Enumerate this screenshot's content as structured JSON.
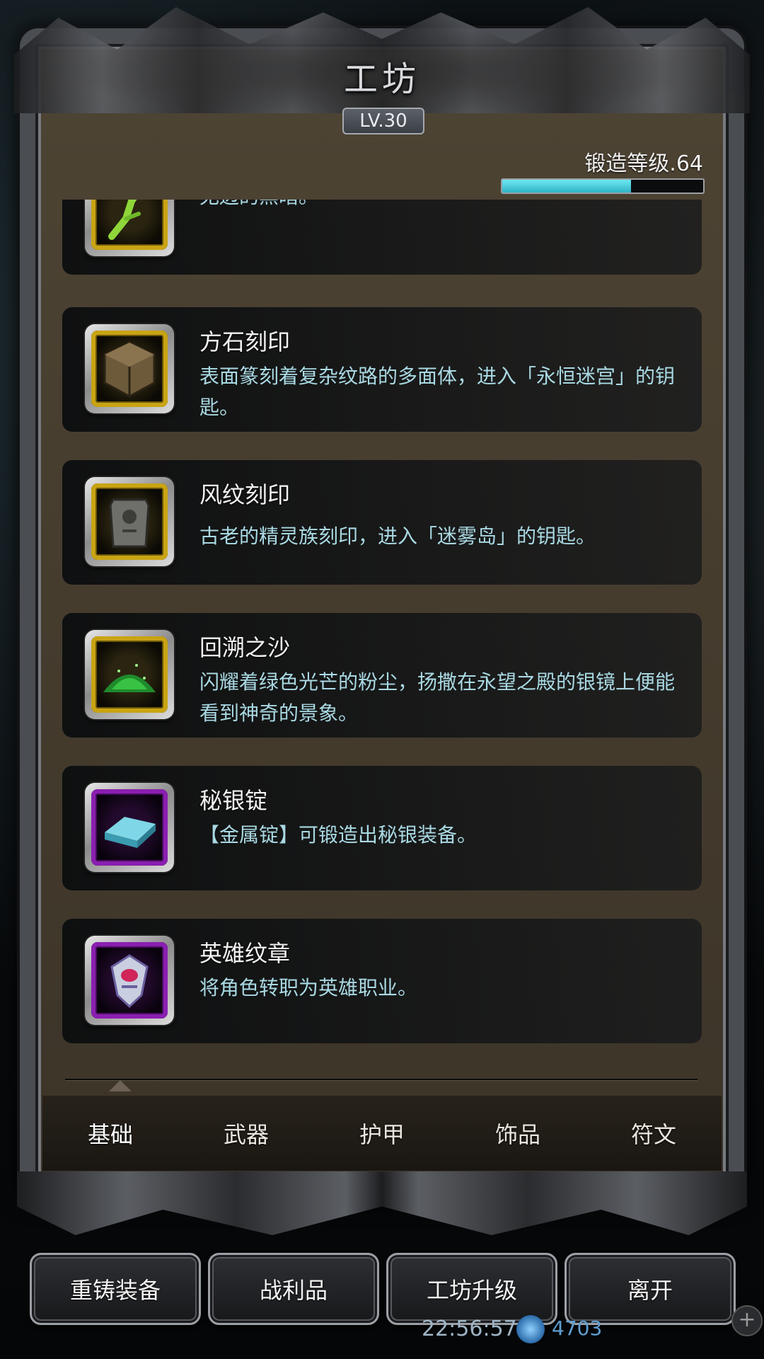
{
  "header": {
    "title": "工坊",
    "level": "LV.30",
    "forge_level_label": "锻造等级.64",
    "forge_progress": 0.64
  },
  "items": [
    {
      "name": "",
      "desc": "树枝的尖端被施加了神圣的力量，发出的光芒可以驱散无边的黑暗。",
      "frame": "gold",
      "icon": "glowing-branch-icon"
    },
    {
      "name": "方石刻印",
      "desc": "表面篆刻着复杂纹路的多面体，进入「永恒迷宫」的钥匙。",
      "frame": "gold",
      "icon": "stone-cube-icon"
    },
    {
      "name": "风纹刻印",
      "desc": "古老的精灵族刻印，进入「迷雾岛」的钥匙。",
      "frame": "gold",
      "icon": "tablet-icon"
    },
    {
      "name": "回溯之沙",
      "desc": "闪耀着绿色光芒的粉尘，扬撒在永望之殿的银镜上便能看到神奇的景象。",
      "frame": "gold",
      "icon": "green-sand-icon"
    },
    {
      "name": "秘银锭",
      "desc": "【金属锭】可锻造出秘银装备。",
      "frame": "purple",
      "icon": "mithril-ingot-icon"
    },
    {
      "name": "英雄纹章",
      "desc": "将角色转职为英雄职业。",
      "frame": "purple",
      "icon": "hero-crest-icon"
    }
  ],
  "tabs": [
    {
      "label": "基础",
      "active": true
    },
    {
      "label": "武器",
      "active": false
    },
    {
      "label": "护甲",
      "active": false
    },
    {
      "label": "饰品",
      "active": false
    },
    {
      "label": "符文",
      "active": false
    }
  ],
  "buttons": {
    "reforge": "重铸装备",
    "loot": "战利品",
    "upgrade": "工坊升级",
    "leave": "离开"
  },
  "status": {
    "time": "22:56:57",
    "gems": "4703"
  },
  "colors": {
    "accent_cyan": "#3fc3d2",
    "desc_text": "#a9d9e3",
    "gold_frame": "#c9a413",
    "purple_frame": "#8a1fb0"
  }
}
